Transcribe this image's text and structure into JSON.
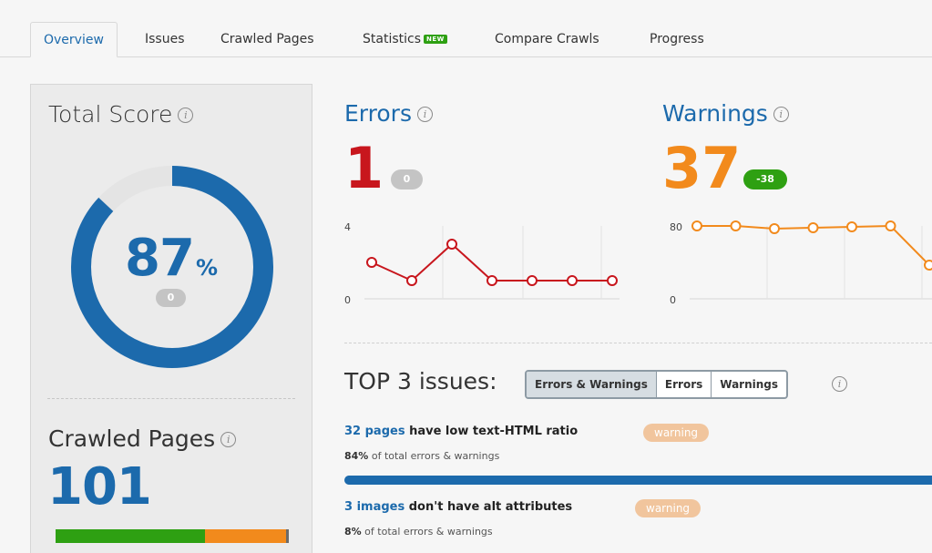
{
  "tabs": [
    {
      "label": "Overview",
      "active": true
    },
    {
      "label": "Issues"
    },
    {
      "label": "Crawled Pages"
    },
    {
      "label": "Statistics",
      "badge": "NEW"
    },
    {
      "label": "Compare Crawls"
    },
    {
      "label": "Progress"
    }
  ],
  "total_score": {
    "title": "Total Score",
    "value": "87",
    "unit": "%",
    "percent": 87,
    "delta": "0",
    "colors": {
      "arc": "#1c6aac",
      "track": "#e4e4e4"
    }
  },
  "crawled_pages": {
    "title": "Crawled Pages",
    "value": "101",
    "bar_fractions": {
      "green": 0.64,
      "orange": 0.35,
      "grey": 0.01
    },
    "colors": {
      "green": "#2ea012",
      "orange": "#f28a1c",
      "grey": "#6b6b6b"
    }
  },
  "errors": {
    "title": "Errors",
    "value": "1",
    "delta": "0",
    "color": "#c8161d"
  },
  "warnings": {
    "title": "Warnings",
    "value": "37",
    "delta": "-38",
    "color": "#f28a1c",
    "delta_color": "#2ea012"
  },
  "chart_data": [
    {
      "type": "line",
      "series": [
        {
          "values": [
            2,
            1,
            3,
            1,
            1,
            1,
            1
          ]
        }
      ],
      "ylim": [
        0,
        4
      ],
      "yticks": [
        "0",
        "4"
      ],
      "color": "#c8161d"
    },
    {
      "type": "line",
      "series": [
        {
          "values": [
            80,
            80,
            77,
            78,
            79,
            80,
            37
          ]
        }
      ],
      "ylim": [
        0,
        80
      ],
      "yticks": [
        "0",
        "80"
      ],
      "color": "#f28a1c"
    }
  ],
  "top_issues": {
    "title": "TOP 3 issues:",
    "filters": [
      "Errors & Warnings",
      "Errors",
      "Warnings"
    ],
    "active_filter": "Errors & Warnings",
    "items": [
      {
        "link": "32 pages",
        "text": " have low text-HTML ratio",
        "badge": "warning",
        "pct": "84%",
        "sub": " of total errors & warnings",
        "share": 0.84
      },
      {
        "link": "3 images",
        "text": " don't have alt attributes",
        "badge": "warning",
        "pct": "8%",
        "sub": " of total errors & warnings",
        "share": 0.08
      }
    ]
  }
}
